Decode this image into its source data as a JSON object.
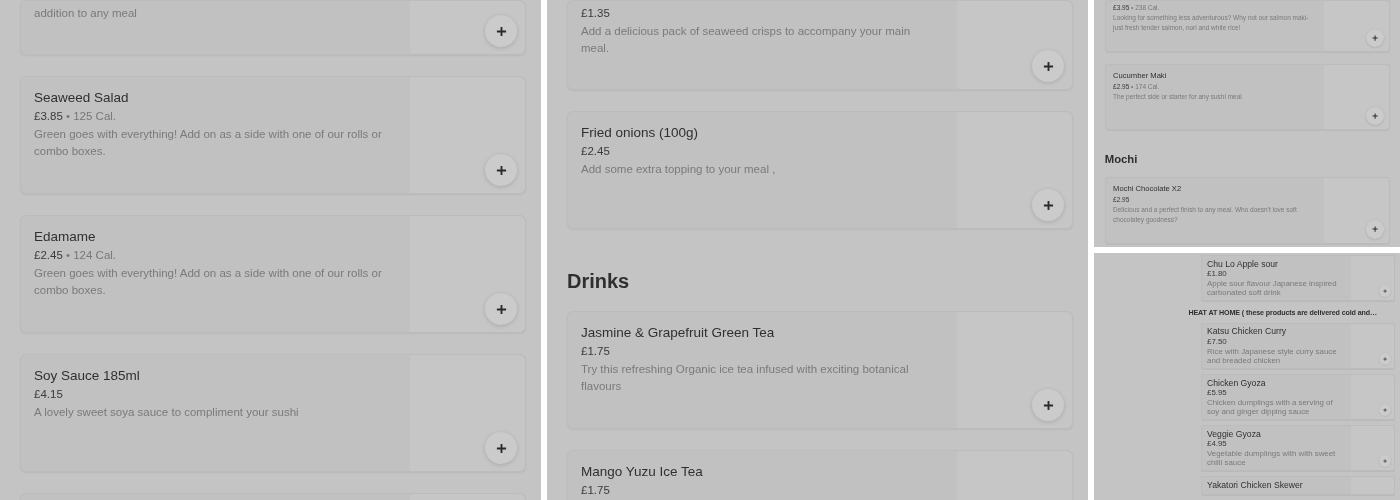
{
  "panels": [
    {
      "blocks": [
        {
          "kind": "item",
          "description": "addition to any meal"
        },
        {
          "kind": "item",
          "name": "Seaweed Salad",
          "price": "£3.85",
          "calories": "• 125 Cal.",
          "description": "Green goes with everything! Add on as a side with one of our rolls or combo boxes."
        },
        {
          "kind": "item",
          "name": "Edamame",
          "price": "£2.45",
          "calories": "• 124 Cal.",
          "description": "Green goes with everything! Add on as a side with one of our rolls or combo boxes."
        },
        {
          "kind": "item",
          "name": "Soy Sauce 185ml",
          "price": "£4.15",
          "description": "A lovely sweet soya sauce to compliment your sushi"
        },
        {
          "kind": "item"
        }
      ]
    },
    {
      "blocks": [
        {
          "kind": "item",
          "price": "£1.35",
          "description": "Add a delicious pack of seaweed crisps to accompany your main meal."
        },
        {
          "kind": "item",
          "name": "Fried onions (100g)",
          "price": "£2.45",
          "description": "Add some extra topping to your meal ,"
        },
        {
          "kind": "section",
          "title": "Drinks"
        },
        {
          "kind": "item",
          "name": "Jasmine & Grapefruit Green Tea",
          "price": "£1.75",
          "description": "Try this refreshing Organic ice tea infused with exciting botanical flavours"
        },
        {
          "kind": "item",
          "name": "Mango Yuzu Ice Tea",
          "price": "£1.75"
        }
      ]
    },
    {
      "blocks": [
        {
          "kind": "item",
          "price": "£3.95",
          "calories": "• 238 Cal.",
          "description": "Looking for something less adventurous? Why not our salmon maki- just fresh tender salmon, nori and white rice!"
        },
        {
          "kind": "item",
          "name": "Cucumber Maki",
          "price": "£2.95",
          "calories": "• 174 Cal.",
          "description": "The perfect side or starter for any sushi meal"
        },
        {
          "kind": "section",
          "title": "Mochi"
        },
        {
          "kind": "item",
          "name": "Mochi Chocolate X2",
          "price": "£2.95",
          "description": "Delicious and a perfect finish to any meal. Who doesn't love soft chocolatey goodness?"
        }
      ]
    },
    {
      "blocks": [
        {
          "kind": "item",
          "name": "Chu Lo Apple sour",
          "price": "£1.80",
          "description": "Apple sour flavour Japanese inspired carbonated soft drink"
        },
        {
          "kind": "section",
          "title": "HEAT AT HOME ( these products are delivered cold and…"
        },
        {
          "kind": "item",
          "name": "Katsu Chicken Curry",
          "price": "£7.50",
          "description": "Rice with Japanese style curry sauce and breaded chicken"
        },
        {
          "kind": "item",
          "name": "Chicken Gyoza",
          "price": "£5.95",
          "description": "Chicken dumplings with a serving of soy and ginger dipping sauce"
        },
        {
          "kind": "item",
          "name": "Veggie Gyoza",
          "price": "£4.95",
          "description": "Vegetable dumplings with with sweet chilli sauce"
        },
        {
          "kind": "item",
          "name": "Yakatori Chicken Skewer"
        }
      ]
    }
  ]
}
